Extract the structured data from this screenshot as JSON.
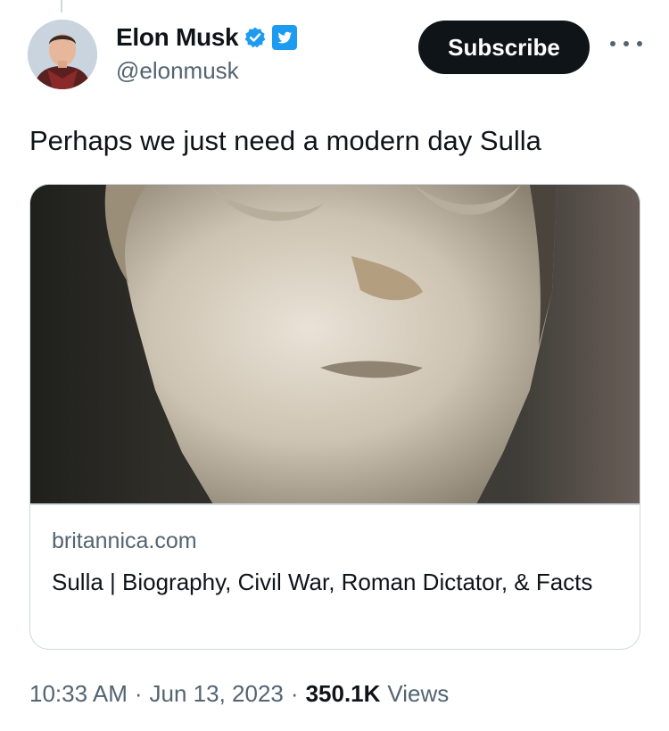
{
  "tweet": {
    "author": {
      "display_name": "Elon Musk",
      "handle": "@elonmusk",
      "verified": true
    },
    "subscribe_label": "Subscribe",
    "text": "Perhaps we just need a modern day Sulla",
    "card": {
      "domain": "britannica.com",
      "title": "Sulla | Biography, Civil War, Roman Dictator, & Facts"
    },
    "meta": {
      "time": "10:33 AM",
      "separator": "·",
      "date": "Jun 13, 2023",
      "views_count": "350.1K",
      "views_label": "Views"
    }
  },
  "icons": {
    "verified": "verified-badge-icon",
    "affiliation": "twitter-bird-icon",
    "more": "more-horizontal-icon"
  },
  "colors": {
    "verified_blue": "#1d9bf0",
    "button_bg": "#0f1419",
    "secondary_text": "#536471",
    "border": "#cfd9de"
  }
}
